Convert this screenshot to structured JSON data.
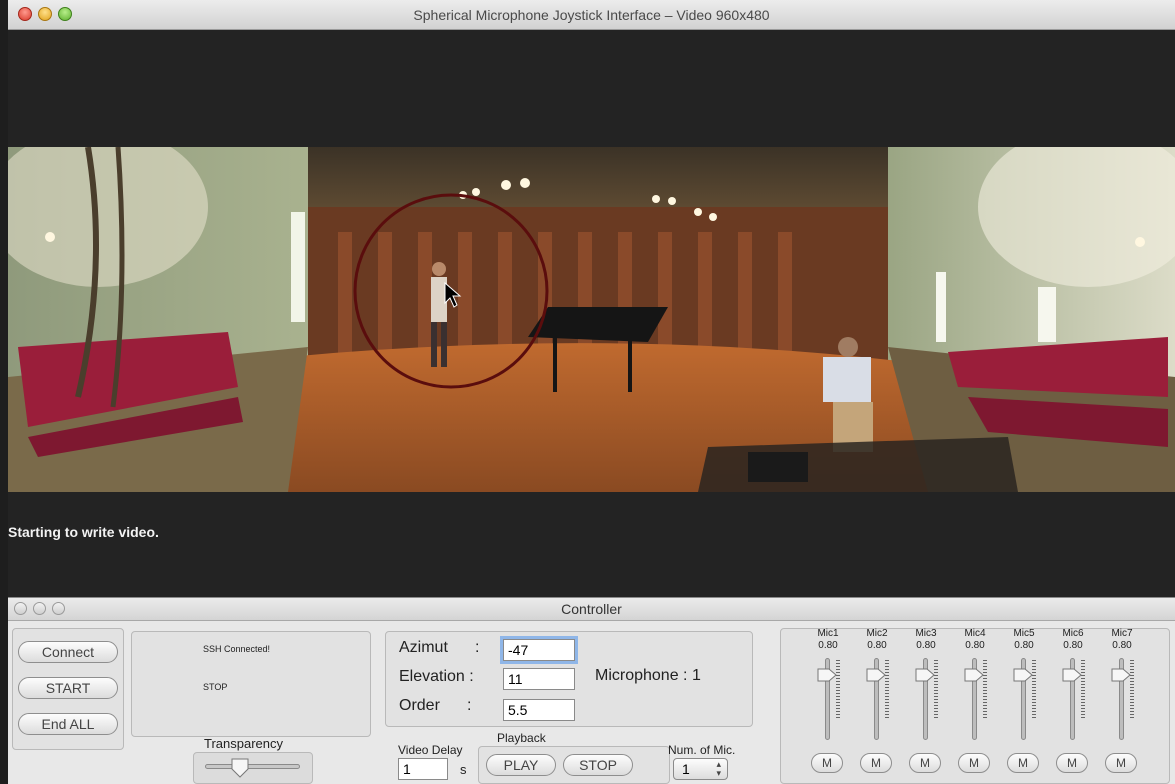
{
  "video_window": {
    "title": "Spherical Microphone Joystick Interface – Video 960x480",
    "status_message": "Starting to write video."
  },
  "controller": {
    "title": "Controller",
    "buttons": {
      "connect": "Connect",
      "start": "START",
      "end_all": "End ALL"
    },
    "log": {
      "line1": "SSH Connected!",
      "line2": "STOP"
    },
    "transparency_label": "Transparency",
    "params": {
      "azimut_label": "Azimut",
      "azimut_value": "-47",
      "elevation_label": "Elevation :",
      "elevation_value": "11",
      "order_label": "Order",
      "order_value": "5.5",
      "colon": ":",
      "microphone_label": "Microphone : 1"
    },
    "video_delay": {
      "label": "Video Delay",
      "value": "1",
      "unit": "s"
    },
    "playback": {
      "label": "Playback",
      "play": "PLAY",
      "stop": "STOP"
    },
    "num_mic": {
      "label": "Num. of Mic.",
      "value": "1"
    },
    "mics": [
      {
        "name": "Mic1",
        "value": "0.80",
        "mute": "M"
      },
      {
        "name": "Mic2",
        "value": "0.80",
        "mute": "M"
      },
      {
        "name": "Mic3",
        "value": "0.80",
        "mute": "M"
      },
      {
        "name": "Mic4",
        "value": "0.80",
        "mute": "M"
      },
      {
        "name": "Mic5",
        "value": "0.80",
        "mute": "M"
      },
      {
        "name": "Mic6",
        "value": "0.80",
        "mute": "M"
      },
      {
        "name": "Mic7",
        "value": "0.80",
        "mute": "M"
      }
    ]
  },
  "colors": {
    "circle": "#5a0d0d",
    "focus_ring": "#8fb6e8"
  }
}
